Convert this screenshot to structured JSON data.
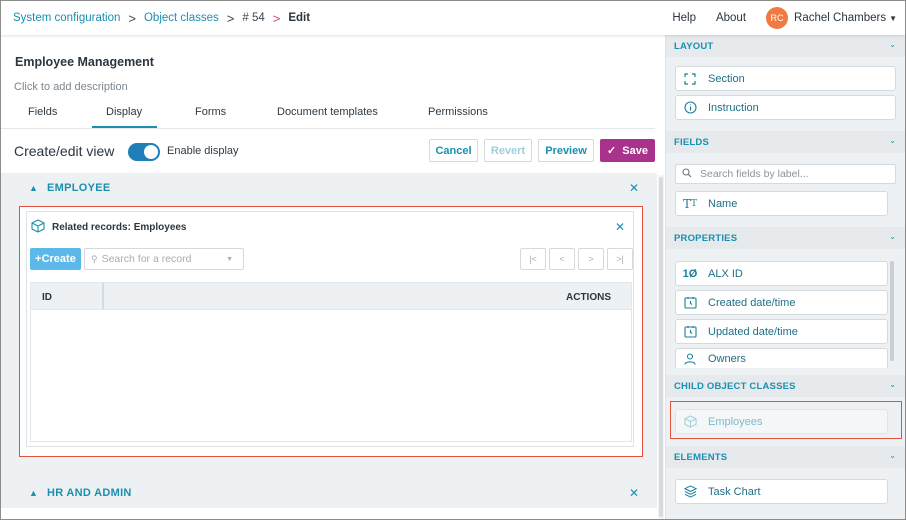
{
  "breadcrumb": {
    "items": [
      "System configuration",
      "Object classes",
      "# 54",
      "Edit"
    ],
    "separator": ">"
  },
  "topnav": {
    "help": "Help",
    "about": "About",
    "user_initials": "RC",
    "user_name": "Rachel Chambers"
  },
  "page": {
    "title": "Employee Management",
    "description_placeholder": "Click to add description"
  },
  "tabs": [
    {
      "label": "Fields"
    },
    {
      "label": "Display"
    },
    {
      "label": "Forms"
    },
    {
      "label": "Document templates"
    },
    {
      "label": "Permissions"
    }
  ],
  "active_tab": "Display",
  "view": {
    "title": "Create/edit view",
    "toggle_label": "Enable display",
    "toggle_on": true,
    "buttons": {
      "cancel": "Cancel",
      "revert": "Revert",
      "preview": "Preview",
      "save": "Save"
    }
  },
  "sections": [
    {
      "label": "EMPLOYEE"
    },
    {
      "label": "HR AND ADMIN"
    }
  ],
  "related_records": {
    "title": "Related records: Employees",
    "create_label": "+Create",
    "search_placeholder": "Search for a record",
    "columns": [
      "ID",
      "ACTIONS"
    ]
  },
  "sidebar": {
    "layout": {
      "title": "LAYOUT",
      "items": [
        "Section",
        "Instruction"
      ]
    },
    "fields": {
      "title": "FIELDS",
      "search_placeholder": "Search fields by label...",
      "items": [
        "Name"
      ]
    },
    "properties": {
      "title": "PROPERTIES",
      "items": [
        "ALX ID",
        "Created date/time",
        "Updated date/time",
        "Owners"
      ]
    },
    "child_object_classes": {
      "title": "CHILD OBJECT CLASSES",
      "items": [
        "Employees"
      ]
    },
    "elements": {
      "title": "ELEMENTS",
      "items": [
        "Task Chart"
      ]
    }
  },
  "colors": {
    "accent": "#1a8fb0",
    "save": "#a8328c",
    "toggle": "#1f7fb8",
    "highlight_outline": "#e0533a",
    "avatar": "#f07a42",
    "create_button": "#5bb8e8"
  },
  "icons": {
    "section": "section-frame-icon",
    "instruction": "info-circle-icon",
    "name": "text-type-icon",
    "alx_id": "id-icon",
    "created": "calendar-clock-icon",
    "updated": "calendar-clock-icon",
    "owners": "person-icon",
    "employees": "cube-icon",
    "task_chart": "cube-stack-icon"
  }
}
